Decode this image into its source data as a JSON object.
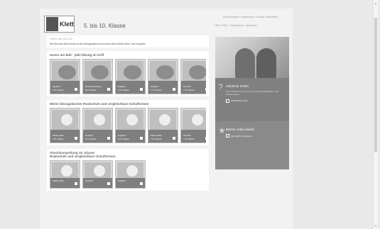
{
  "header": {
    "brand": "Klett",
    "grade": "5. bis 10. Klasse",
    "meta_line_1": "Servicebereich | Impressum | Kontakt | Newsletter",
    "meta_line_2": "Hilfe & FAQ  ·  Datenschutz  ·  Anmelden"
  },
  "intro": {
    "title": "Wählen dein Buch aus.",
    "text": "Mit Klick aufs Buch siehst du alle Übungskapitel und kommst dann deinen Buch-Code eingeben."
  },
  "section1": {
    "title": "Immer am Ball - jede Übung im Griff",
    "items": [
      {
        "label": "Deutsch",
        "sub": "5./6. Klasse"
      },
      {
        "label": "Rechtschreibung",
        "sub": "5./6. Klasse"
      },
      {
        "label": "Englisch",
        "sub": "5./6. Klasse"
      },
      {
        "label": "Englisch",
        "sub": "7./8. Klasse"
      },
      {
        "label": "Deutsch",
        "sub": "7./8. Klasse"
      }
    ]
  },
  "section2": {
    "title": "Meine Übungsbücher Realschule und vergleichbare Schulformen",
    "items": [
      {
        "label": "Mathematik",
        "sub": "5./6. Klasse"
      },
      {
        "label": "Deutsch",
        "sub": "5./6. Klasse"
      },
      {
        "label": "Englisch",
        "sub": "5./6. Klasse"
      },
      {
        "label": "Mathematik",
        "sub": "7./8. Klasse"
      },
      {
        "label": "Deutsch",
        "sub": "7./8. Klasse"
      }
    ]
  },
  "section3": {
    "title": "Abschlussprüfung 10. Klasse",
    "subtitle": "Realschule und vergleichbare Schulformen",
    "items": [
      {
        "label": "Mathematik"
      },
      {
        "label": "Deutsch"
      },
      {
        "label": "Englisch"
      }
    ]
  },
  "sidebar": {
    "block1_title": "Schritt für Schritt",
    "block1_text": "Hier erfährst du, was das ist, wie Übungsbücher in die Schule gehen.",
    "block1_button": "Ausführliche Infos",
    "block2_title": "Bücher online kaufen",
    "block2_button": "Hier geht's zu klett.de"
  }
}
